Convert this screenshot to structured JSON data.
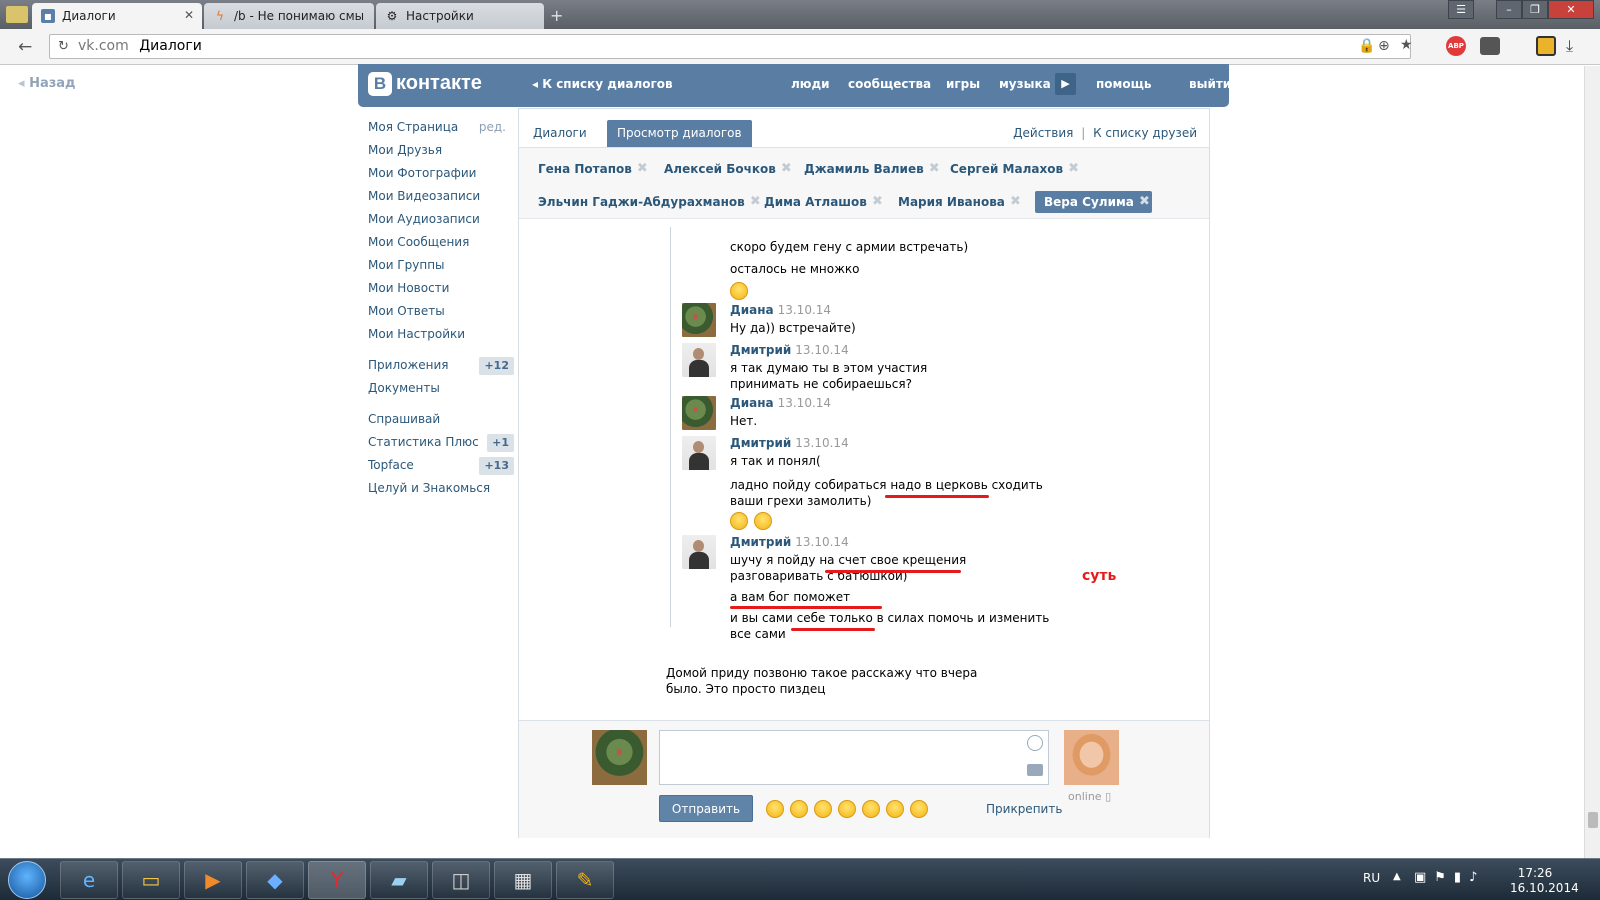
{
  "browser": {
    "tabs": [
      {
        "title": "Диалоги",
        "icon": "vk-icon",
        "active": true
      },
      {
        "title": "/b - Не понимаю смы",
        "icon": "bolt-icon",
        "active": false
      },
      {
        "title": "Настройки",
        "icon": "gear-icon",
        "active": false
      }
    ],
    "url_host": "vk.com",
    "url_title": "Диалоги",
    "window_buttons": {
      "menu": "☰",
      "minimize": "–",
      "restore": "❐",
      "close": "✕"
    }
  },
  "page": {
    "back_label": "Назад",
    "logo_text": "контакте",
    "logo_letter": "В",
    "header": {
      "to_dialogs": "◂ К списку диалогов",
      "nav": [
        "люди",
        "сообщества",
        "игры",
        "музыка",
        "помощь",
        "выйти"
      ]
    },
    "left_nav": {
      "edit_label": "ред.",
      "items": [
        {
          "label": "Моя Страница"
        },
        {
          "label": "Мои Друзья"
        },
        {
          "label": "Мои Фотографии"
        },
        {
          "label": "Мои Видеозаписи"
        },
        {
          "label": "Мои Аудиозаписи"
        },
        {
          "label": "Мои Сообщения"
        },
        {
          "label": "Мои Группы"
        },
        {
          "label": "Мои Новости"
        },
        {
          "label": "Мои Ответы"
        },
        {
          "label": "Мои Настройки"
        }
      ],
      "apps": [
        {
          "label": "Приложения",
          "badge": "+12"
        },
        {
          "label": "Документы",
          "badge": ""
        }
      ],
      "extra": [
        {
          "label": "Спрашивай",
          "badge": ""
        },
        {
          "label": "Статистика Плюс",
          "badge": "+1"
        },
        {
          "label": "Topface",
          "badge": "+13"
        },
        {
          "label": "Целуй и Знакомься",
          "badge": ""
        }
      ]
    },
    "panel": {
      "tabs": [
        "Диалоги",
        "Просмотр диалогов"
      ],
      "actions": "Действия",
      "separator": "|",
      "to_friends": "К списку друзей",
      "peers": [
        "Гена Потапов",
        "Алексей Бочков",
        "Джамиль Валиев",
        "Сергей Малахов",
        "Эльчин Гаджи-Абдурахманов",
        "Дима Атлашов",
        "Мария Иванова",
        "Вера Сулима"
      ],
      "peer_close": "✖"
    },
    "messages": {
      "top_lines": [
        "скоро будем гену с армии встречать)",
        "осталось не множко"
      ],
      "items": [
        {
          "author": "Диана",
          "date": "13.10.14",
          "text": "Ну да)) встречайте)"
        },
        {
          "author": "Дмитрий",
          "date": "13.10.14",
          "text": "я так думаю ты в этом участия принимать не собираешься?"
        },
        {
          "author": "Диана",
          "date": "13.10.14",
          "text": "Нет."
        },
        {
          "author": "Дмитрий",
          "date": "13.10.14",
          "text": "я так и понял("
        },
        {
          "author": "",
          "date": "",
          "text": "ладно пойду собираться надо в церковь сходить ваши грехи замолить)"
        },
        {
          "author": "Дмитрий",
          "date": "13.10.14",
          "text": "шучу я пойду на счет свое крещения разговаривать с батюшкой)"
        },
        {
          "author": "",
          "date": "",
          "text": "а вам бог поможет"
        },
        {
          "author": "",
          "date": "",
          "text": "и вы сами себе только в силах помочь и изменить все сами"
        }
      ],
      "annotation": "суть",
      "outer_message": "Домой приду позвоню такое расскажу что вчера было. Это просто пиздец"
    },
    "compose": {
      "send_label": "Отправить",
      "attach_label": "Прикрепить",
      "online_label": "online"
    }
  },
  "taskbar": {
    "lang": "RU",
    "time": "17:26",
    "date": "16.10.2014"
  }
}
